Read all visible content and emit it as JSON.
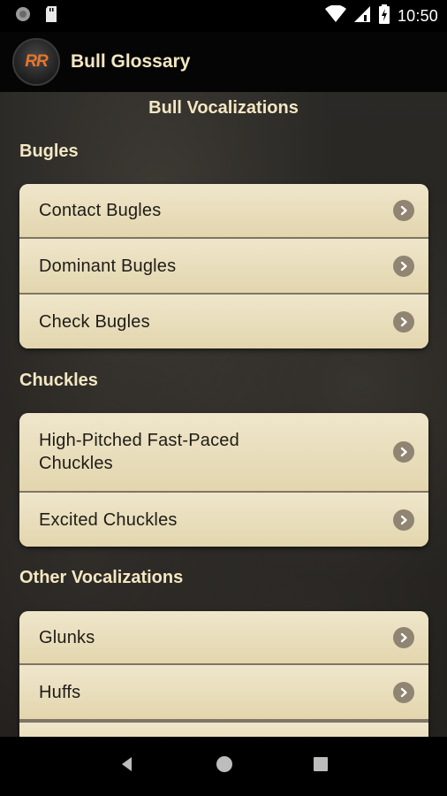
{
  "status_bar": {
    "time": "10:50",
    "icons": [
      "record-icon",
      "sd-card-icon",
      "wifi-icon",
      "signal-icon",
      "battery-charging-icon"
    ]
  },
  "app_bar": {
    "logo_text": "RR",
    "title": "Bull Glossary"
  },
  "page": {
    "heading": "Bull Vocalizations"
  },
  "sections": [
    {
      "title": "Bugles",
      "items": [
        "Contact Bugles",
        "Dominant Bugles",
        "Check Bugles"
      ]
    },
    {
      "title": "Chuckles",
      "items": [
        "High-Pitched Fast-Paced Chuckles",
        "Excited Chuckles"
      ]
    },
    {
      "title": "Other Vocalizations",
      "items": [
        "Glunks",
        "Huffs"
      ]
    }
  ],
  "nav_bar": {
    "icons": [
      "back-icon",
      "home-icon",
      "recents-icon"
    ]
  },
  "colors": {
    "accent_text": "#f4e7c2",
    "card_bg": "#e5d8b2",
    "chevron": "#908472",
    "logo": "#e6762a"
  }
}
